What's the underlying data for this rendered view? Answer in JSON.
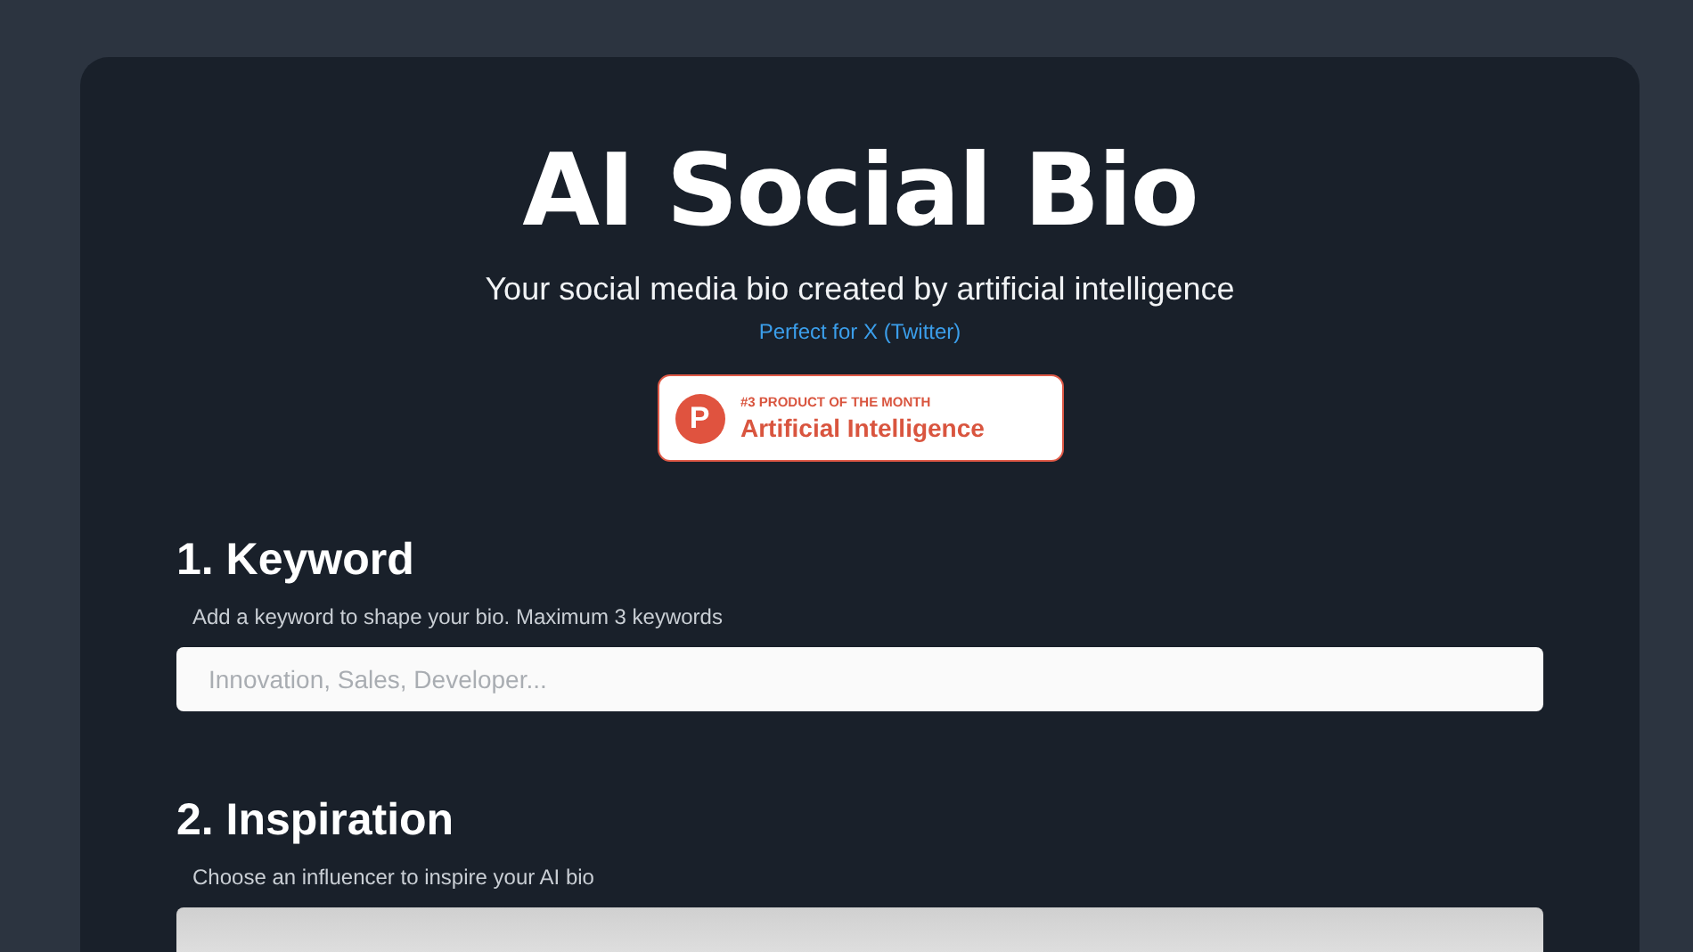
{
  "header": {
    "title": "AI Social Bio",
    "subtitle": "Your social media bio created by artificial intelligence",
    "tagline": "Perfect for X (Twitter)"
  },
  "badge": {
    "letter": "P",
    "rank": "#3 PRODUCT OF THE MONTH",
    "category": "Artificial Intelligence"
  },
  "sections": [
    {
      "kind": "text-input",
      "heading": "1. Keyword",
      "hint": "Add a keyword to shape your bio. Maximum 3 keywords",
      "placeholder": "Innovation, Sales, Developer..."
    },
    {
      "kind": "picker",
      "heading": "2. Inspiration",
      "hint": "Choose an influencer to inspire your AI bio"
    }
  ]
}
